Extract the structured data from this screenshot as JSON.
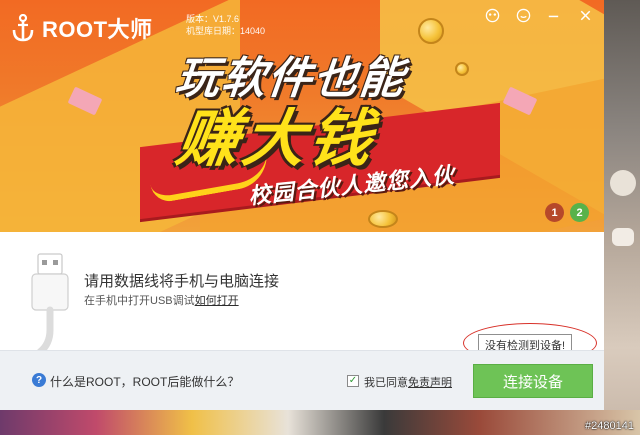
{
  "app": {
    "logo_text": "ROOT大师",
    "version_line": "版本：V1.7.6",
    "db_date_line": "机型库日期：14040"
  },
  "window_controls": {
    "icons": [
      "skin-icon",
      "feedback-icon",
      "minimize-icon",
      "close-icon"
    ]
  },
  "banner": {
    "headline_top": "玩软件也能",
    "headline_main": "赚大钱",
    "tagline": "校园合伙人邀您入伙",
    "pager": [
      "1",
      "2"
    ],
    "active_page": 2
  },
  "instructions": {
    "title": "请用数据线将手机与电脑连接",
    "sub_prefix": "在手机中打开USB调试",
    "sub_link": "如何打开"
  },
  "tooltip": "没有检测到设备!",
  "footer": {
    "help_text": "什么是ROOT，ROOT后能做什么？",
    "agree_prefix": "我已同意",
    "agree_link": "免责声明",
    "agree_checked": true,
    "connect_button": "连接设备"
  },
  "watermark": "#2480141",
  "colors": {
    "banner_orange": "#f26a23",
    "button_green": "#6ec356",
    "highlight_red": "#d8322a"
  }
}
